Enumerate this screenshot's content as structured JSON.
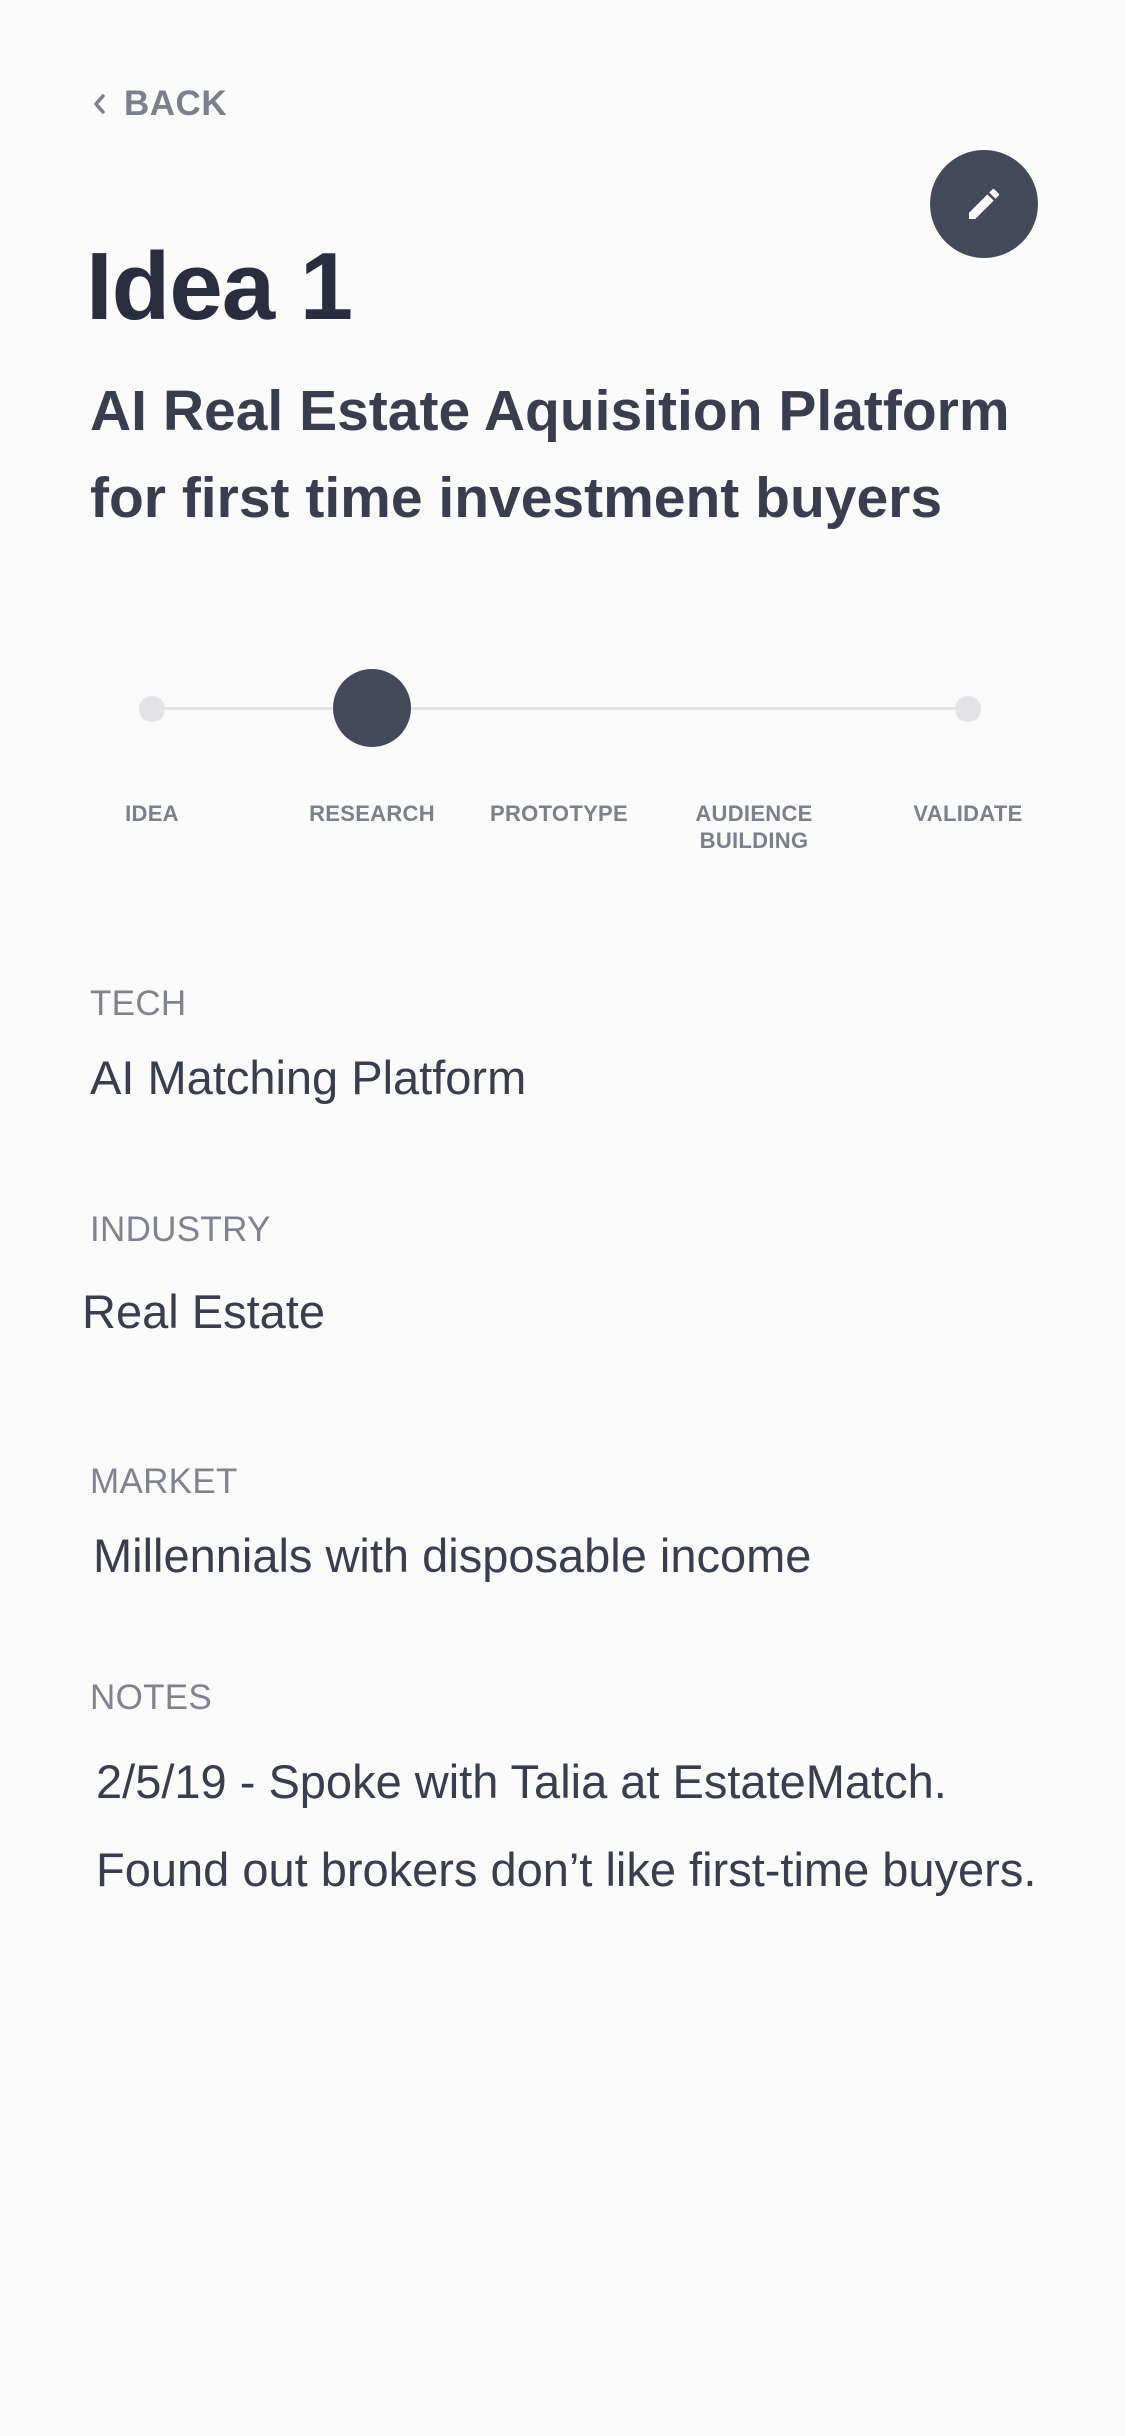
{
  "nav": {
    "back_label": "BACK"
  },
  "idea": {
    "title": "Idea 1",
    "subtitle": "AI Real Estate Aquisition Platform for first time investment buyers"
  },
  "stepper": {
    "current_step_index": 1,
    "steps": [
      {
        "label": "IDEA"
      },
      {
        "label": "RESEARCH"
      },
      {
        "label": "PROTOTYPE"
      },
      {
        "label": "AUDIENCE\nBUILDING"
      },
      {
        "label": "VALIDATE"
      }
    ]
  },
  "fields": {
    "tech": {
      "label": "TECH",
      "value": "AI Matching Platform"
    },
    "industry": {
      "label": "INDUSTRY",
      "value": "Real Estate"
    },
    "market": {
      "label": "MARKET",
      "value": "Millennials with disposable income"
    },
    "notes": {
      "label": "NOTES",
      "line1": "2/5/19 - Spoke with Talia at EstateMatch.",
      "line2": "Found out brokers don’t like first-time buyers."
    }
  },
  "icons": {
    "back": "chevron-left-icon",
    "edit": "pencil-icon"
  },
  "colors": {
    "background": "#FAFAFB",
    "accent": "#434959",
    "heading": "#2A2D3E",
    "muted": "#7C7F8C",
    "track": "#E3E3E6"
  }
}
